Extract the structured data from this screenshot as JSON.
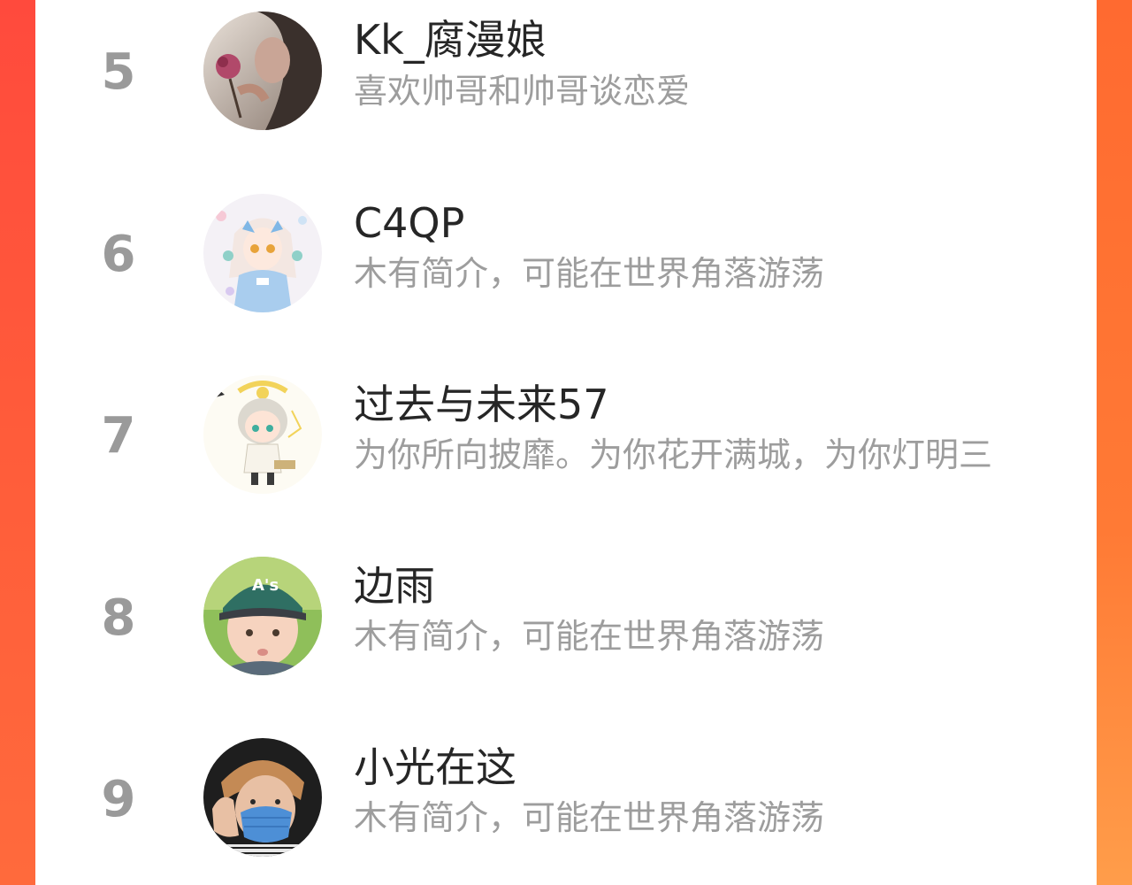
{
  "colors": {
    "background_accent": "#ff5a3a",
    "rank_text": "#9a9a9a",
    "name_text": "#262626",
    "bio_text": "#9d9d9d"
  },
  "ranking": {
    "items": [
      {
        "rank": "5",
        "name": "Kk_腐漫娘",
        "bio": "喜欢帅哥和帅哥谈恋爱",
        "avatar": "avatar-rose-portrait"
      },
      {
        "rank": "6",
        "name": "C4QP",
        "bio": "木有简介，可能在世界角落游荡",
        "avatar": "avatar-anime-girl"
      },
      {
        "rank": "7",
        "name": "过去与未来57",
        "bio": "为你所向披靡。为你花开满城，为你灯明三",
        "avatar": "avatar-chibi-boy"
      },
      {
        "rank": "8",
        "name": "边雨",
        "bio": "木有简介，可能在世界角落游荡",
        "avatar": "avatar-child-cap"
      },
      {
        "rank": "9",
        "name": "小光在这",
        "bio": "木有简介，可能在世界角落游荡",
        "avatar": "avatar-boy-mask"
      }
    ]
  }
}
